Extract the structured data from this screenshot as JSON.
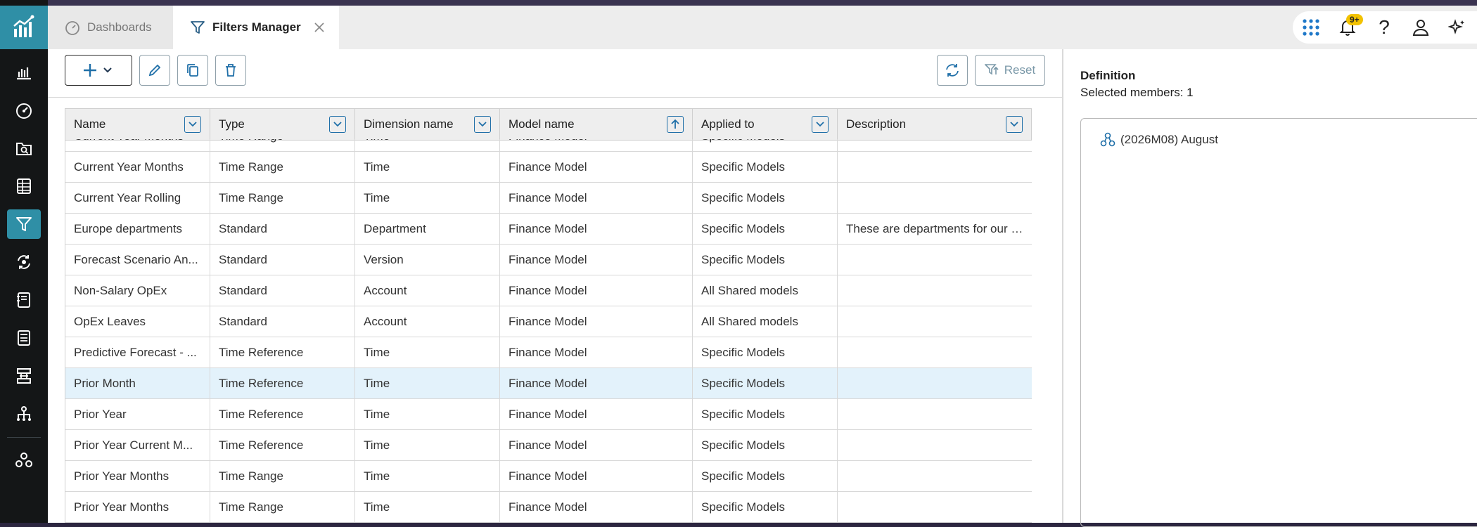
{
  "tabs": [
    {
      "label": "Dashboards",
      "icon": "gauge-icon",
      "active": false
    },
    {
      "label": "Filters Manager",
      "icon": "funnel-icon",
      "active": true
    }
  ],
  "top_icons": {
    "apps": "grid-icon",
    "notifications": "bell-icon",
    "notifications_badge": "9+",
    "help": "?",
    "user": "user-icon",
    "ai": "sparkle-icon"
  },
  "rail_icons": [
    "logo-icon",
    "bar-chart-icon",
    "gauge-icon",
    "folder-search-icon",
    "grid-table-icon",
    "funnel-icon",
    "cycle-icon",
    "notebook-icon",
    "calculator-icon",
    "table-transfer-icon",
    "hierarchy-icon",
    "network-icon"
  ],
  "toolbar": {
    "add": "add-dropdown",
    "edit": "pencil-icon",
    "copy": "copy-icon",
    "delete": "trash-icon",
    "refresh": "refresh-icon",
    "reset_label": "Reset"
  },
  "grid": {
    "columns": [
      "Name",
      "Type",
      "Dimension name",
      "Model name",
      "Applied to",
      "Description"
    ],
    "sort_column": "Model name",
    "rows": [
      [
        "Current Year Months",
        "Time Range",
        "Time",
        "Finance Model",
        "Specific Models",
        ""
      ],
      [
        "Current Year Months",
        "Time Range",
        "Time",
        "Finance Model",
        "Specific Models",
        ""
      ],
      [
        "Current Year Rolling",
        "Time Range",
        "Time",
        "Finance Model",
        "Specific Models",
        ""
      ],
      [
        "Europe departments",
        "Standard",
        "Department",
        "Finance Model",
        "Specific Models",
        "These are departments for our E..."
      ],
      [
        "Forecast Scenario An...",
        "Standard",
        "Version",
        "Finance Model",
        "Specific Models",
        ""
      ],
      [
        "Non-Salary OpEx",
        "Standard",
        "Account",
        "Finance Model",
        "All Shared models",
        ""
      ],
      [
        "OpEx Leaves",
        "Standard",
        "Account",
        "Finance Model",
        "All Shared models",
        ""
      ],
      [
        "Predictive Forecast - ...",
        "Time Reference",
        "Time",
        "Finance Model",
        "Specific Models",
        ""
      ],
      [
        "Prior Month",
        "Time Reference",
        "Time",
        "Finance Model",
        "Specific Models",
        ""
      ],
      [
        "Prior Year",
        "Time Reference",
        "Time",
        "Finance Model",
        "Specific Models",
        ""
      ],
      [
        "Prior Year Current M...",
        "Time Reference",
        "Time",
        "Finance Model",
        "Specific Models",
        ""
      ],
      [
        "Prior Year Months",
        "Time Range",
        "Time",
        "Finance Model",
        "Specific Models",
        ""
      ],
      [
        "Prior Year Months",
        "Time Range",
        "Time",
        "Finance Model",
        "Specific Models",
        ""
      ]
    ],
    "selected_row": 8
  },
  "panel": {
    "title": "Definition",
    "subtitle": "Selected members: 1",
    "members": [
      "(2026M08) August"
    ]
  },
  "colors": {
    "accent": "#2f8fa6",
    "rail": "#141617",
    "selected_row": "#e3f2fb",
    "badge": "#f2c200"
  }
}
